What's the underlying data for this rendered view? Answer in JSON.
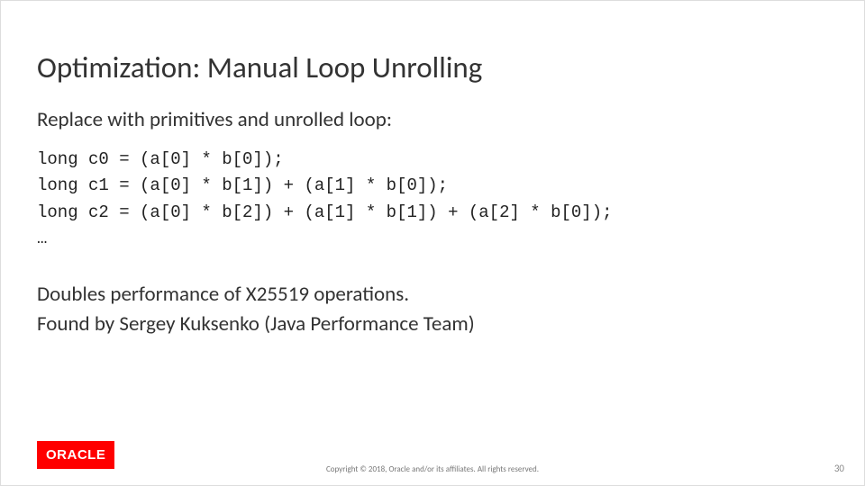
{
  "slide": {
    "title": "Optimization: Manual Loop Unrolling",
    "subtitle": "Replace with primitives and unrolled loop:",
    "code": "long c0 = (a[0] * b[0]);\nlong c1 = (a[0] * b[1]) + (a[1] * b[0]);\nlong c2 = (a[0] * b[2]) + (a[1] * b[1]) + (a[2] * b[0]);\n…",
    "result_line1": "Doubles performance of X25519 operations.",
    "result_line2": "Found by Sergey Kuksenko (Java Performance Team)"
  },
  "footer": {
    "logo_text": "ORACLE",
    "copyright": "Copyright © 2018, Oracle and/or its affiliates. All rights reserved.",
    "page_number": "30"
  }
}
